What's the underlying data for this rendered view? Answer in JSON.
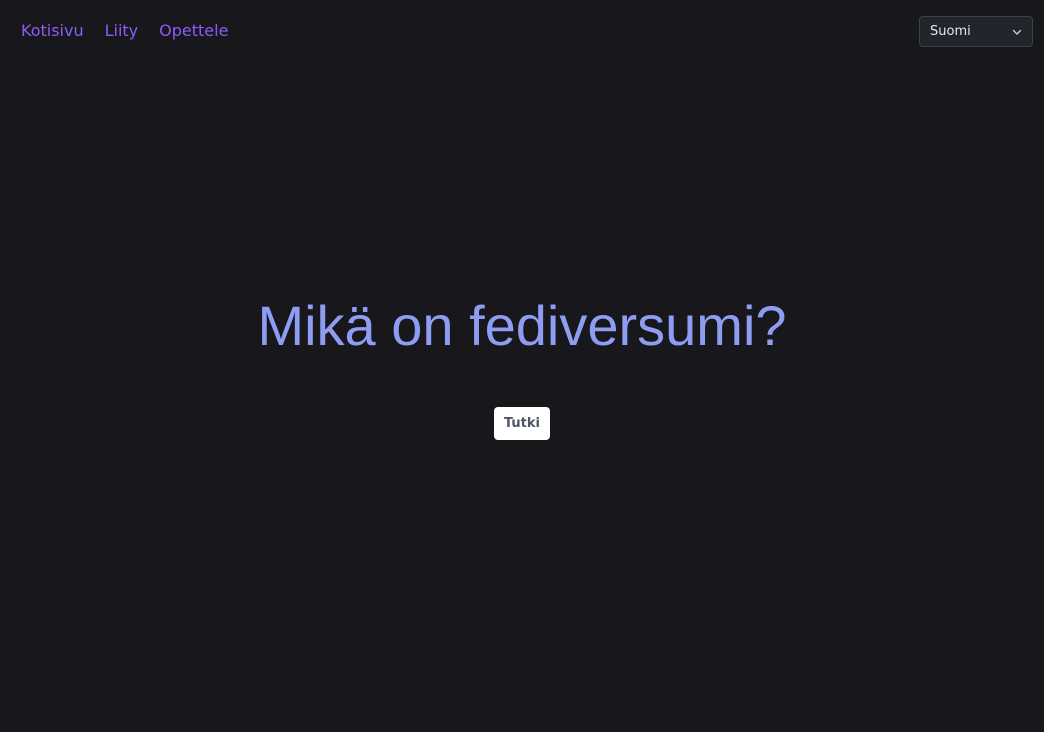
{
  "nav": {
    "items": [
      {
        "label": "Kotisivu"
      },
      {
        "label": "Liity"
      },
      {
        "label": "Opettele"
      }
    ]
  },
  "language_select": {
    "value": "Suomi",
    "icon": "chevron-down-icon"
  },
  "hero": {
    "title": "Mikä on fediversumi?",
    "button_label": "Tutki"
  },
  "colors": {
    "background": "#17171c",
    "nav_link": "#8b5cf6",
    "title": "#8e9cf2",
    "button_bg": "#ffffff",
    "button_text": "#4b5563"
  }
}
